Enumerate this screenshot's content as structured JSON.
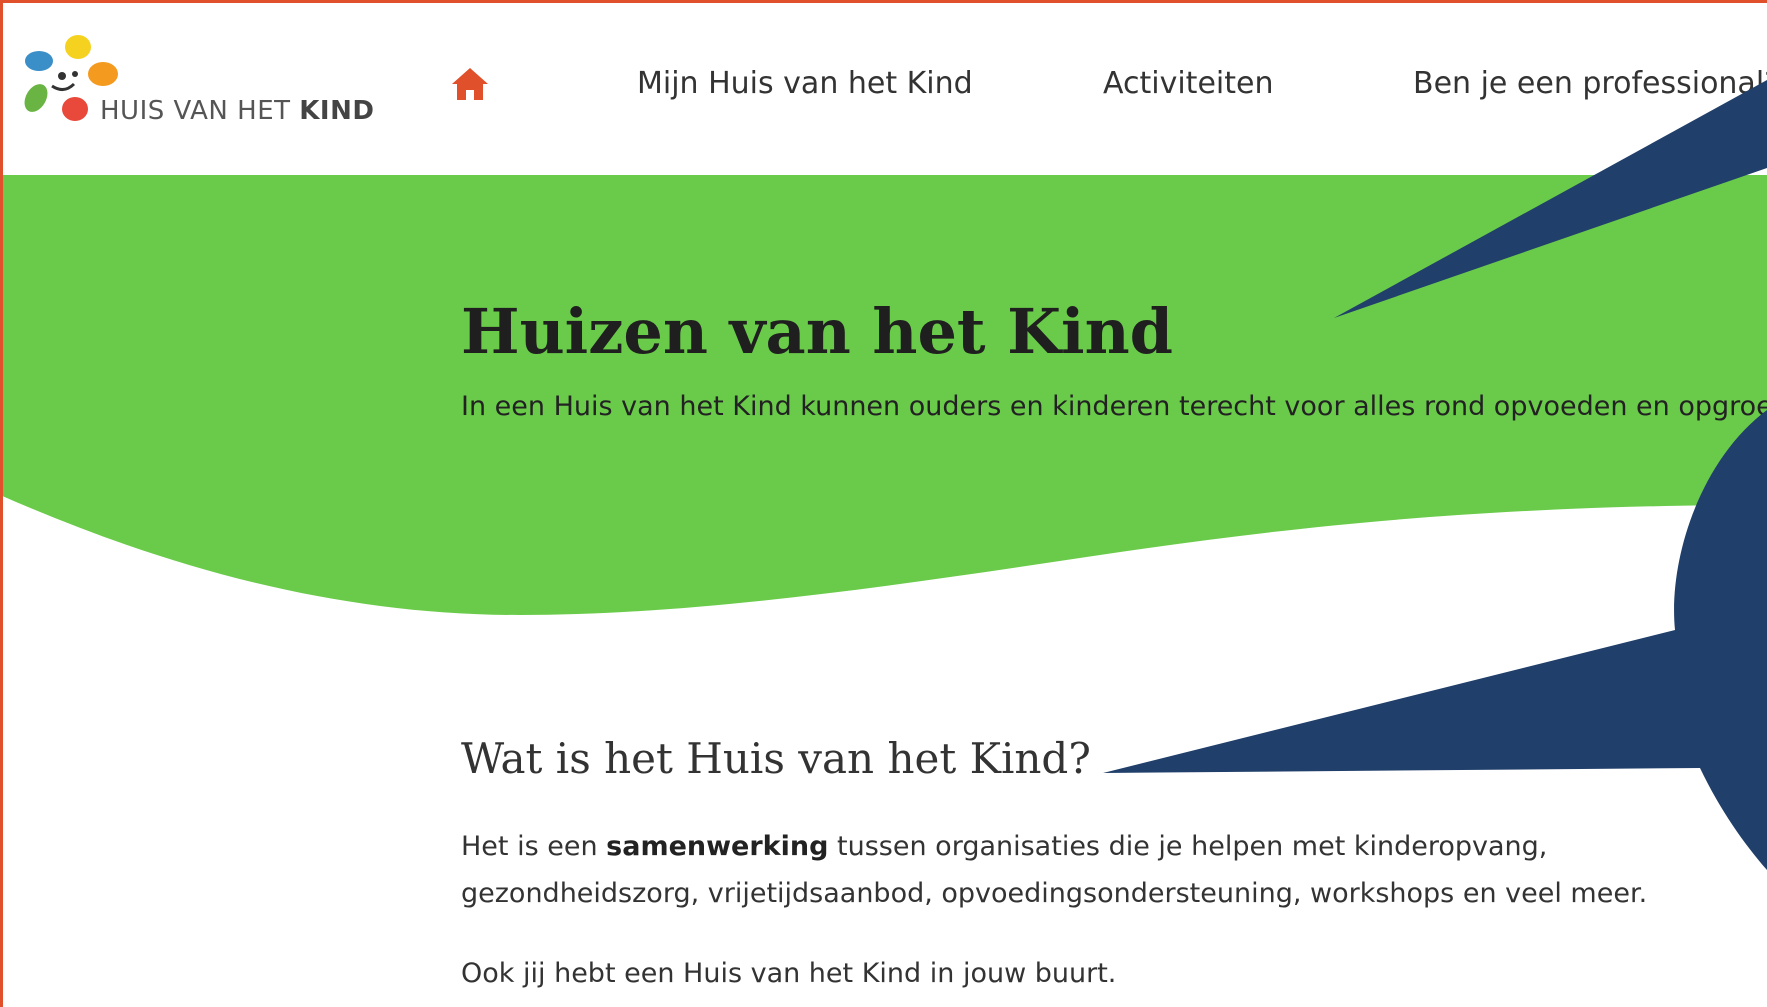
{
  "brand": {
    "logo_text_regular": "HUIS VAN HET ",
    "logo_text_bold": "KIND",
    "colors": {
      "accent_orange": "#e0502a",
      "hero_green": "#6acb4a",
      "annotation_navy": "#203f6a"
    }
  },
  "nav": {
    "home_icon": "home-icon",
    "items": [
      {
        "label": "Mijn Huis van het Kind"
      },
      {
        "label": "Activiteiten"
      },
      {
        "label": "Ben je een professional?"
      }
    ]
  },
  "hero": {
    "title": "Huizen van het Kind",
    "subtitle": "In een Huis van het Kind kunnen ouders en kinderen terecht voor alles rond opvoeden en opgroeien."
  },
  "content": {
    "section_title": "Wat is het Huis van het Kind?",
    "para1_before": "Het is een ",
    "para1_bold": "samenwerking",
    "para1_after": " tussen organisaties die je helpen met kinderopvang, gezondheidszorg, vrijetijdsaanbod, opvoedingsondersteuning, workshops en veel meer.",
    "para2": "Ook jij hebt een Huis van het Kind in jouw buurt."
  }
}
